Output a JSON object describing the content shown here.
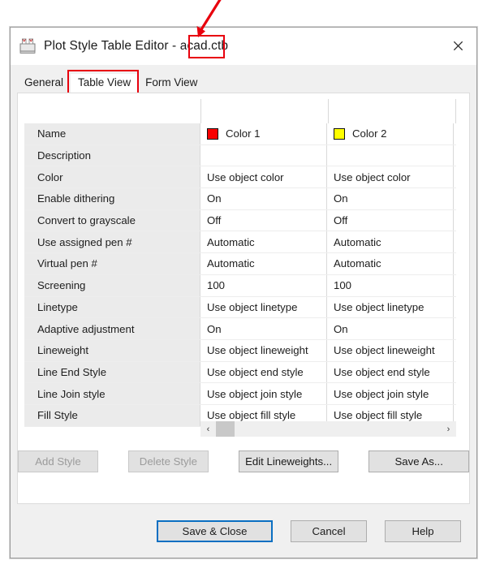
{
  "window": {
    "title": "Plot Style Table Editor - acad.ctb",
    "title_prefix": "Plot Style Table Editor - acad",
    "title_highlighted": ".ctb",
    "icon": "plot-style-table-icon",
    "close_label": "✕"
  },
  "annotations": {
    "arrow_color": "#e8000d",
    "title_box_target": ".ctb",
    "tab_box_target": "Table View"
  },
  "tabs": [
    {
      "label": "General",
      "active": false
    },
    {
      "label": "Table View",
      "active": true
    },
    {
      "label": "Form View",
      "active": false
    }
  ],
  "table": {
    "columns": [
      {
        "name": "Color 1",
        "swatch": "#f90000"
      },
      {
        "name": "Color 2",
        "swatch": "#ffff00"
      }
    ],
    "rows": [
      {
        "label": "Name",
        "values": [
          "Color 1",
          "Color 2"
        ],
        "swatches": [
          "#f90000",
          "#ffff00"
        ]
      },
      {
        "label": "Description",
        "values": [
          "",
          ""
        ]
      },
      {
        "label": "Color",
        "values": [
          "Use object color",
          "Use object color"
        ]
      },
      {
        "label": "Enable dithering",
        "values": [
          "On",
          "On"
        ]
      },
      {
        "label": "Convert to grayscale",
        "values": [
          "Off",
          "Off"
        ]
      },
      {
        "label": "Use assigned pen #",
        "values": [
          "Automatic",
          "Automatic"
        ]
      },
      {
        "label": "Virtual pen #",
        "values": [
          "Automatic",
          "Automatic"
        ]
      },
      {
        "label": "Screening",
        "values": [
          "100",
          "100"
        ]
      },
      {
        "label": "Linetype",
        "values": [
          "Use object linetype",
          "Use object linetype"
        ]
      },
      {
        "label": "Adaptive adjustment",
        "values": [
          "On",
          "On"
        ]
      },
      {
        "label": "Lineweight",
        "values": [
          "Use object lineweight",
          "Use object lineweight"
        ]
      },
      {
        "label": "Line End Style",
        "values": [
          "Use object end style",
          "Use object end style"
        ]
      },
      {
        "label": "Line Join style",
        "values": [
          "Use object join style",
          "Use object join style"
        ]
      },
      {
        "label": "Fill Style",
        "values": [
          "Use object fill style",
          "Use object fill style"
        ]
      }
    ]
  },
  "scrollbar": {
    "left_arrow": "‹",
    "right_arrow": "›",
    "thumb_position_percent": 0
  },
  "style_buttons": [
    {
      "label": "Add Style",
      "enabled": false
    },
    {
      "label": "Delete Style",
      "enabled": false
    },
    {
      "label": "Edit Lineweights...",
      "enabled": true
    },
    {
      "label": "Save As...",
      "enabled": true
    }
  ],
  "footer_buttons": [
    {
      "label": "Save & Close",
      "default": true
    },
    {
      "label": "Cancel",
      "default": false
    },
    {
      "label": "Help",
      "default": false
    }
  ]
}
